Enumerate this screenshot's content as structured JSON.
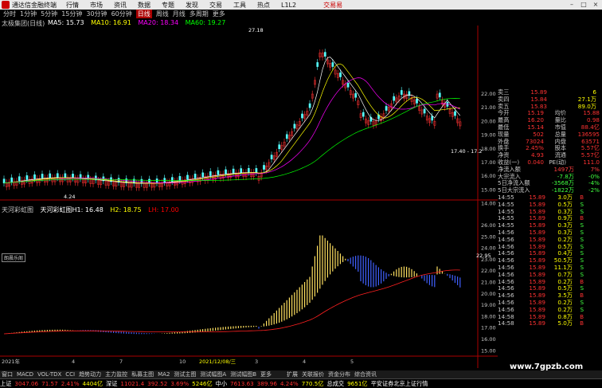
{
  "menubar": {
    "app_title": "通达信金融终端",
    "items": [
      "行情",
      "市场",
      "资讯",
      "数据",
      "专题",
      "发现",
      "交易",
      "工具",
      "热点",
      "L1L2"
    ],
    "account": "交易易"
  },
  "periods": [
    "分时",
    "1分钟",
    "5分钟",
    "15分钟",
    "30分钟",
    "60分钟",
    "日线",
    "周线",
    "月线",
    "多周期",
    "更多"
  ],
  "active_period": "日线",
  "main_chart": {
    "title": "太极集团(日线)",
    "ma": [
      {
        "label": "MA5: 15.73",
        "color": "#ffffff"
      },
      {
        "label": "MA10: 16.91",
        "color": "#ffff00"
      },
      {
        "label": "MA20: 18.34",
        "color": "#ff00ff"
      },
      {
        "label": "MA60: 19.27",
        "color": "#00ff00"
      }
    ],
    "high_label": "27.18",
    "low_label": "4.24",
    "price_labels": [
      "22.00",
      "21.00",
      "20.00",
      "19.00",
      "18.00",
      "17.00",
      "16.00",
      "15.00",
      "14.00"
    ],
    "annotation": "17.40 - 17.2"
  },
  "lower_chart": {
    "title": "天河彩虹图",
    "legend": [
      {
        "label": "天河彩虹图H1: 16.48",
        "color": "#ffffff"
      },
      {
        "label": "H2: 18.75",
        "color": "#ffff00"
      },
      {
        "label": "LH: 17.00",
        "color": "#ff0000"
      }
    ],
    "subtab": "朗晨乐阁",
    "axis_labels": [
      "26.00",
      "25.00",
      "24.00",
      "23.00",
      "22.00",
      "21.00",
      "20.00",
      "19.00",
      "18.00",
      "17.00",
      "16.00",
      "15.00"
    ],
    "current_value": "22.95"
  },
  "date_axis": {
    "labels": [
      "2021年",
      "4",
      "7",
      "10",
      "2021/12/08/三",
      "3",
      "4",
      "5"
    ]
  },
  "quote_panel": {
    "asks": [
      {
        "label": "卖三",
        "price": "15.89",
        "vol": "6"
      },
      {
        "label": "卖四",
        "price": "15.84",
        "vol": "27.1万"
      },
      {
        "label": "卖五",
        "price": "15.83",
        "vol": "89.0万"
      }
    ],
    "stats": [
      {
        "k1": "今开",
        "v1": "15.19",
        "k2": "均价",
        "v2": "15.88"
      },
      {
        "k1": "最高",
        "v1": "16.20",
        "k2": "量比",
        "v2": "0.98"
      },
      {
        "k1": "最低",
        "v1": "15.14",
        "k2": "市值",
        "v2": "88.4亿"
      },
      {
        "k1": "现量",
        "v1": "502",
        "k2": "总量",
        "v2": "136595"
      },
      {
        "k1": "外盘",
        "v1": "73024",
        "k2": "内盘",
        "v2": "63571"
      },
      {
        "k1": "换手",
        "v1": "2.45%",
        "k2": "股本",
        "v2": "5.57亿"
      },
      {
        "k1": "净资",
        "v1": "4.93",
        "k2": "流通",
        "v2": "5.57亿"
      },
      {
        "k1": "收益(一)",
        "v1": "0.040",
        "k2": "PE(动)",
        "v2": "111.0"
      }
    ],
    "flows": [
      {
        "label": "净流入额",
        "value": "1497万",
        "pct": "7%",
        "color": "#ff4040"
      },
      {
        "label": "大宗流入",
        "value": "-7.8万",
        "pct": "-0%",
        "color": "#40ff40"
      },
      {
        "label": "5日净流入额",
        "value": "-3568万",
        "pct": "-4%",
        "color": "#40ff40"
      },
      {
        "label": "5日大宗流入",
        "value": "-1822万",
        "pct": "-2%",
        "color": "#40ff40"
      }
    ],
    "ticks": [
      {
        "t": "14:55",
        "p": "15.89",
        "v": "3.0万",
        "d": "B"
      },
      {
        "t": "14:55",
        "p": "15.89",
        "v": "0.5万",
        "d": "S"
      },
      {
        "t": "14:55",
        "p": "15.89",
        "v": "0.3万",
        "d": "S"
      },
      {
        "t": "14:55",
        "p": "15.89",
        "v": "0.9万",
        "d": "B"
      },
      {
        "t": "14:55",
        "p": "15.89",
        "v": "0.3万",
        "d": "S"
      },
      {
        "t": "14:56",
        "p": "15.89",
        "v": "0.3万",
        "d": "S"
      },
      {
        "t": "14:56",
        "p": "15.89",
        "v": "0.2万",
        "d": "S"
      },
      {
        "t": "14:56",
        "p": "15.89",
        "v": "0.5万",
        "d": "S"
      },
      {
        "t": "14:56",
        "p": "15.89",
        "v": "0.4万",
        "d": "S"
      },
      {
        "t": "14:56",
        "p": "15.89",
        "v": "50.5万",
        "d": "S"
      },
      {
        "t": "14:56",
        "p": "15.89",
        "v": "11.1万",
        "d": "S"
      },
      {
        "t": "14:56",
        "p": "15.89",
        "v": "0.7万",
        "d": "S"
      },
      {
        "t": "14:56",
        "p": "15.89",
        "v": "0.2万",
        "d": "B"
      },
      {
        "t": "14:56",
        "p": "15.89",
        "v": "0.5万",
        "d": "S"
      },
      {
        "t": "14:56",
        "p": "15.89",
        "v": "3.5万",
        "d": "B"
      },
      {
        "t": "14:56",
        "p": "15.89",
        "v": "0.2万",
        "d": "S"
      },
      {
        "t": "14:56",
        "p": "15.89",
        "v": "0.2万",
        "d": "S"
      },
      {
        "t": "14:58",
        "p": "15.89",
        "v": "0.8万",
        "d": "B"
      },
      {
        "t": "14:58",
        "p": "15.89",
        "v": "5.0万",
        "d": "B"
      }
    ]
  },
  "bottom_tabs": [
    "扩展",
    "关联报价",
    "资金分布",
    "综合资讯",
    "行业资讯",
    "互动问答",
    "短周产品利中章",
    "设置"
  ],
  "indicator_tabs": [
    "窗口",
    "MACD",
    "VOL-TDX",
    "CCI",
    "趋势动力",
    "主力监控",
    "私募主图",
    "MA2",
    "测试主图",
    "测试幅图A",
    "测试幅图B",
    "更多"
  ],
  "status": {
    "sh_label": "上证",
    "sh_value": "3047.06",
    "sh_chg": "71.57",
    "sh_pct": "2.41%",
    "sh_amt": "4404亿",
    "sz_label": "深证",
    "sz_value": "11021.4",
    "sz_chg": "392.52",
    "sz_pct": "3.69%",
    "sz_amt": "5246亿",
    "zx_label": "中小",
    "zx_value": "7613.63",
    "zx_chg": "389.96",
    "zx_pct": "4.24%",
    "zx_amt": "770.5亿",
    "total_label": "总成交",
    "total_value": "9651亿",
    "news": "平安证券北京上证行情"
  },
  "watermark": "www.7gpzb.com",
  "colors": {
    "up": "#ff3232",
    "down": "#54ffff",
    "accent": "#c00000"
  }
}
